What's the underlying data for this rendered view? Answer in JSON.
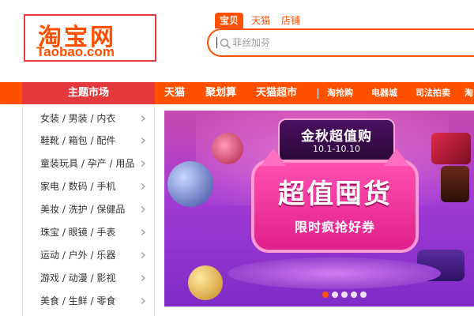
{
  "logo": {
    "cn": "淘宝网",
    "en": "Taobao.com"
  },
  "search": {
    "tabs": [
      {
        "label": "宝贝",
        "active": true
      },
      {
        "label": "天猫",
        "active": false
      },
      {
        "label": "店铺",
        "active": false
      }
    ],
    "placeholder": "菲丝加芬"
  },
  "nav": {
    "category_title": "主题市场",
    "items": [
      "天猫",
      "聚划算",
      "天猫超市",
      "淘抢购",
      "电器城",
      "司法拍卖",
      "淘"
    ]
  },
  "categories": [
    "女装 / 男装 / 内衣",
    "鞋靴 / 箱包 / 配件",
    "童装玩具 / 孕产 / 用品",
    "家电 / 数码 / 手机",
    "美妆 / 洗护 / 保健品",
    "珠宝 / 眼镜 / 手表",
    "运动 / 户外 / 乐器",
    "游戏 / 动漫 / 影视",
    "美食 / 生鲜 / 零食"
  ],
  "banner": {
    "top_title": "金秋超值购",
    "date": "10.1-10.10",
    "main_title": "超值囤货",
    "sub_title": "限时疯抢好券",
    "dots": 5,
    "active_dot": 0
  },
  "colors": {
    "brand_orange": "#ff5000",
    "category_red": "#e4393c"
  }
}
